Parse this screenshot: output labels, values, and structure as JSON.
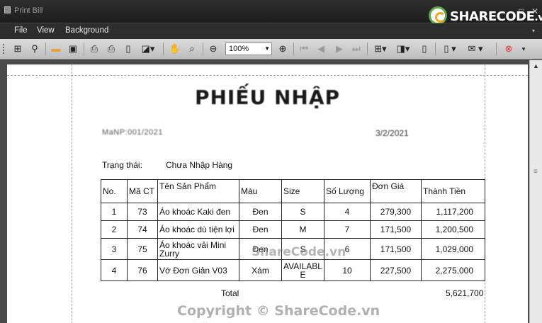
{
  "window": {
    "title": "Print Bill",
    "minimize": "–",
    "maximize": "□",
    "close": "✕"
  },
  "watermark": {
    "logo_text": "SHARECODE",
    "logo_suffix": ".vn",
    "center": "ShareCode.vn",
    "copyright": "Copyright © ShareCode.vn"
  },
  "menu": {
    "file": "File",
    "view": "View",
    "background": "Background",
    "overflow": "▾"
  },
  "toolbar": {
    "zoom_value": "100%",
    "icons": [
      "toggle-sidebar-icon",
      "find-icon",
      "open-icon",
      "save-icon",
      "print-icon",
      "quick-print-icon",
      "page-setup-icon",
      "scale-icon",
      "hand-tool-icon",
      "magnifier-icon",
      "zoom-out-icon",
      "zoom-in-icon",
      "first-page-icon",
      "previous-page-icon",
      "next-page-icon",
      "last-page-icon",
      "multiple-pages-icon",
      "color-icon",
      "watermark-icon",
      "export-icon",
      "send-email-icon",
      "close-preview-icon"
    ]
  },
  "document": {
    "title": "PHIẾU NHẬP",
    "code": "MaNP:001/2021",
    "date": "3/2/2021",
    "status_label": "Trạng thái:",
    "status_value": "Chưa Nhập Hàng",
    "columns": [
      "No.",
      "Mã CT",
      "Tên Sản Phẩm",
      "Màu",
      "Size",
      "Số Lượng",
      "Đơn Giá",
      "Thành Tiền"
    ],
    "rows": [
      {
        "no": "1",
        "code": "73",
        "name": "Áo khoác Kaki đen",
        "color": "Đen",
        "size": "S",
        "qty": "4",
        "price": "279,300",
        "total": "1,117,200"
      },
      {
        "no": "2",
        "code": "74",
        "name": "Áo khoác dù tiện lợi",
        "color": "Đen",
        "size": "M",
        "qty": "7",
        "price": "171,500",
        "total": "1,200,500"
      },
      {
        "no": "3",
        "code": "75",
        "name": "Áo khoác vải Mini Zurry",
        "color": "Đen",
        "size": "S",
        "qty": "6",
        "price": "171,500",
        "total": "1,029,000"
      },
      {
        "no": "4",
        "code": "76",
        "name": "Vớ Đơn Giản V03",
        "color": "Xám",
        "size": "AVAILABLE",
        "qty": "10",
        "price": "227,500",
        "total": "2,275,000"
      }
    ],
    "total_label": "Total",
    "total_value": "5,621,700"
  }
}
